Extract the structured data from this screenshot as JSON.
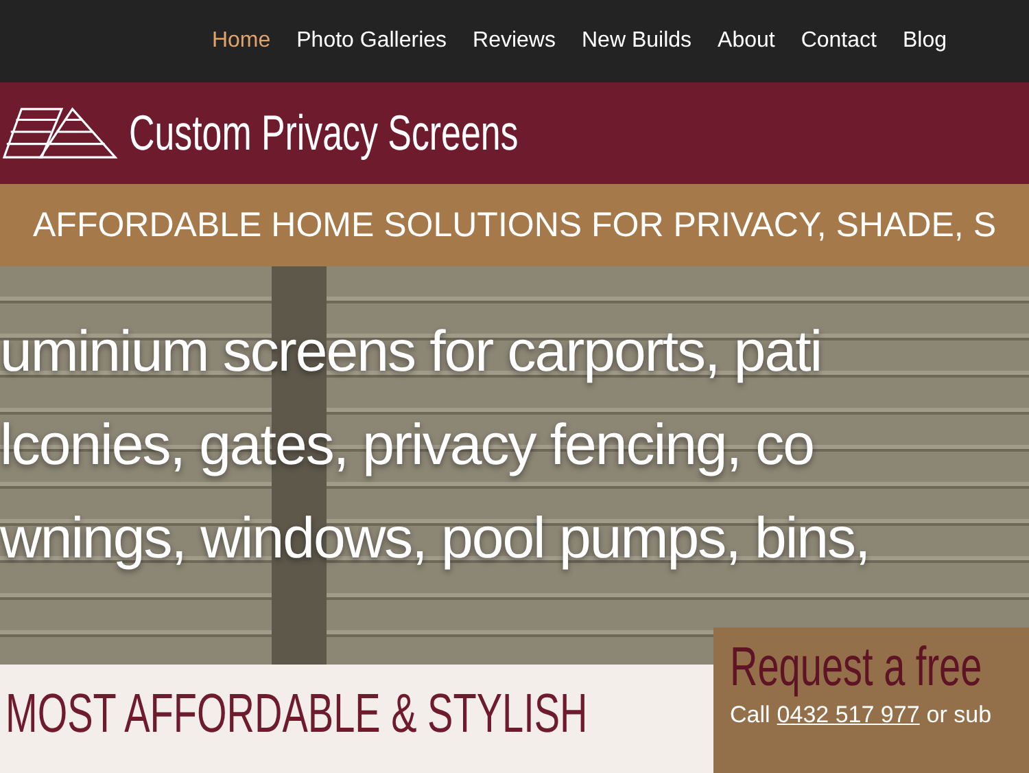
{
  "nav": {
    "items": [
      {
        "label": "Home",
        "selected": true
      },
      {
        "label": "Photo Galleries",
        "selected": false
      },
      {
        "label": "Reviews",
        "selected": false
      },
      {
        "label": "New Builds",
        "selected": false
      },
      {
        "label": "About",
        "selected": false
      },
      {
        "label": "Contact",
        "selected": false
      },
      {
        "label": "Blog",
        "selected": false
      }
    ]
  },
  "header": {
    "title": "Custom Privacy Screens"
  },
  "tagline": "AFFORDABLE HOME SOLUTIONS FOR PRIVACY, SHADE, S",
  "hero": {
    "lines": [
      "uminium screens for carports, pati",
      "lconies, gates, privacy fencing, co",
      "wnings, windows, pool pumps, bins,"
    ]
  },
  "intro": {
    "heading": "MOST AFFORDABLE & STYLISH"
  },
  "quote": {
    "title": "Request a free",
    "call": "Call",
    "phone": "0432 517 977",
    "rest": "or sub"
  }
}
